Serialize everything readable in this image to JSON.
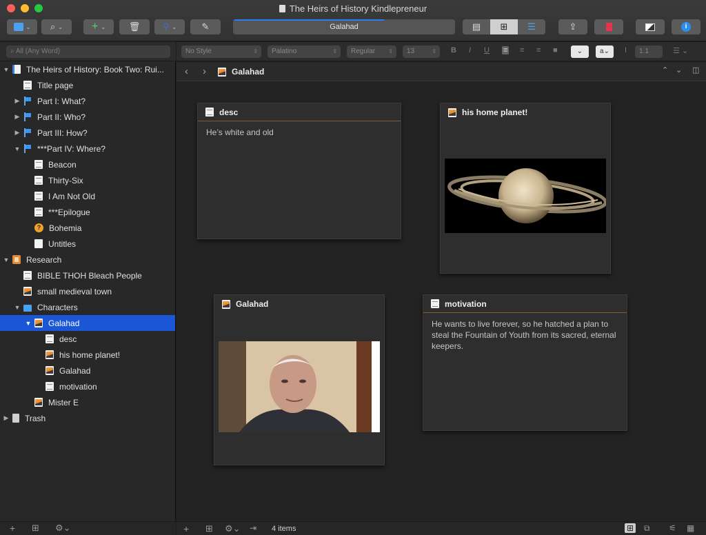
{
  "window": {
    "title": "The Heirs of History Kindlepreneur"
  },
  "toolbar": {
    "title_field": "Galahad"
  },
  "search": {
    "placeholder": "All (Any Word)"
  },
  "format": {
    "style": "No Style",
    "font": "Palatino",
    "weight": "Regular",
    "size": "13",
    "bold": "B",
    "italic": "I",
    "underline": "U",
    "text_color_label": "a",
    "line_spacing": "1.1"
  },
  "binder": [
    {
      "label": "The Heirs of History: Book Two: Rui...",
      "icon": "book-icon",
      "disc": "▼"
    },
    {
      "label": "Title page",
      "icon": "document-icon",
      "disc": ""
    },
    {
      "label": "Part I: What?",
      "icon": "flag-icon",
      "disc": "▶"
    },
    {
      "label": "Part II: Who?",
      "icon": "flag-icon",
      "disc": "▶"
    },
    {
      "label": "Part III: How?",
      "icon": "flag-icon",
      "disc": "▶"
    },
    {
      "label": "***Part IV: Where?",
      "icon": "flag-icon",
      "disc": "▼"
    },
    {
      "label": "Beacon",
      "icon": "document-icon",
      "disc": ""
    },
    {
      "label": "Thirty-Six",
      "icon": "document-icon",
      "disc": ""
    },
    {
      "label": "I Am Not Old",
      "icon": "document-icon",
      "disc": ""
    },
    {
      "label": "***Epilogue",
      "icon": "document-icon",
      "disc": ""
    },
    {
      "label": "Bohemia",
      "icon": "question-icon",
      "disc": ""
    },
    {
      "label": "Untitles",
      "icon": "blank-document-icon",
      "disc": ""
    },
    {
      "label": "Research",
      "icon": "research-icon",
      "disc": "▼"
    },
    {
      "label": "BIBLE THOH Bleach People",
      "icon": "document-icon",
      "disc": ""
    },
    {
      "label": "small medieval town",
      "icon": "image-icon",
      "disc": ""
    },
    {
      "label": "Characters",
      "icon": "folder-icon",
      "disc": "▼"
    },
    {
      "label": "Galahad",
      "icon": "image-icon",
      "disc": "▼"
    },
    {
      "label": "desc",
      "icon": "document-icon",
      "disc": ""
    },
    {
      "label": "his home planet!",
      "icon": "image-icon",
      "disc": ""
    },
    {
      "label": "Galahad",
      "icon": "image-icon",
      "disc": ""
    },
    {
      "label": "motivation",
      "icon": "document-icon",
      "disc": ""
    },
    {
      "label": "Mister E",
      "icon": "image-icon",
      "disc": ""
    },
    {
      "label": "Trash",
      "icon": "trash-icon",
      "disc": "▶"
    }
  ],
  "path": {
    "current": "Galahad"
  },
  "cards": [
    {
      "title": "desc",
      "icon": "document-icon",
      "text": "He’s white and old"
    },
    {
      "title": "his home planet!",
      "icon": "image-icon",
      "text": ""
    },
    {
      "title": "Galahad",
      "icon": "image-icon",
      "text": ""
    },
    {
      "title": "motivation",
      "icon": "document-icon",
      "text": "He wants to live forever, so he hatched a plan to steal the Fountain of Youth from its sacred, eternal keepers."
    }
  ],
  "status": {
    "count": "4 items"
  },
  "colors": {
    "selection": "#1a56d6",
    "flag": "#3d95ef",
    "card_rule": "#8a5a2a"
  }
}
